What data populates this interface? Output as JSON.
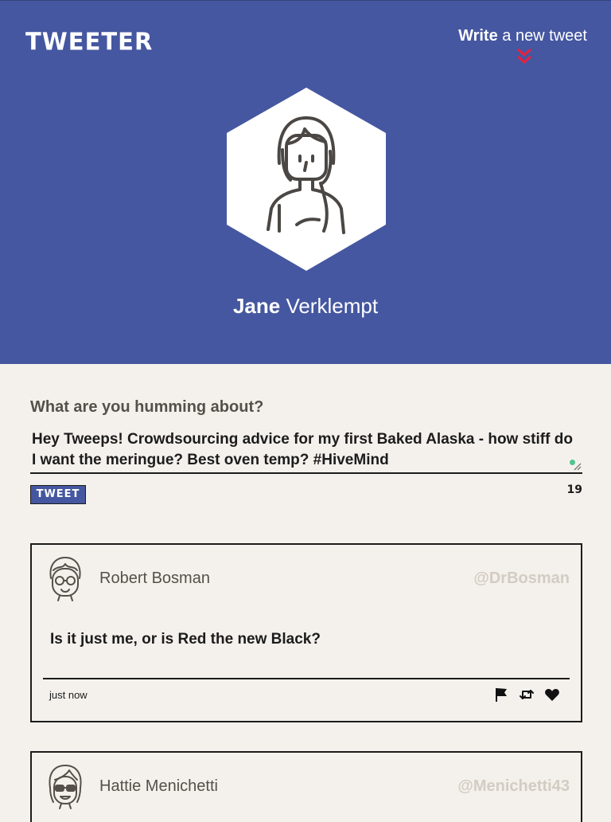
{
  "header": {
    "logo": "TWEETER",
    "write_bold": "Write",
    "write_rest": " a new tweet"
  },
  "profile": {
    "first_name": "Jane",
    "last_name": "Verklempt"
  },
  "compose": {
    "label": "What are you humming about?",
    "text": "Hey Tweeps! Crowdsourcing advice for my first Baked Alaska - how stiff do I want the meringue? Best oven temp? #HiveMind",
    "button": "TWEET",
    "counter": "19"
  },
  "tweets": [
    {
      "name": "Robert Bosman",
      "handle": "@DrBosman",
      "content": "Is it just me, or is Red the new Black?",
      "time": "just now"
    },
    {
      "name": "Hattie Menichetti",
      "handle": "@Menichetti43"
    }
  ],
  "colors": {
    "header_bg": "#4557a0",
    "page_bg": "#f4f1ec",
    "accent_red": "#e8213f",
    "handle_grey": "#d3ccc3"
  },
  "icons": [
    "chevrons-down-icon",
    "user-avatar-icon",
    "flag-icon",
    "retweet-icon",
    "heart-icon"
  ]
}
